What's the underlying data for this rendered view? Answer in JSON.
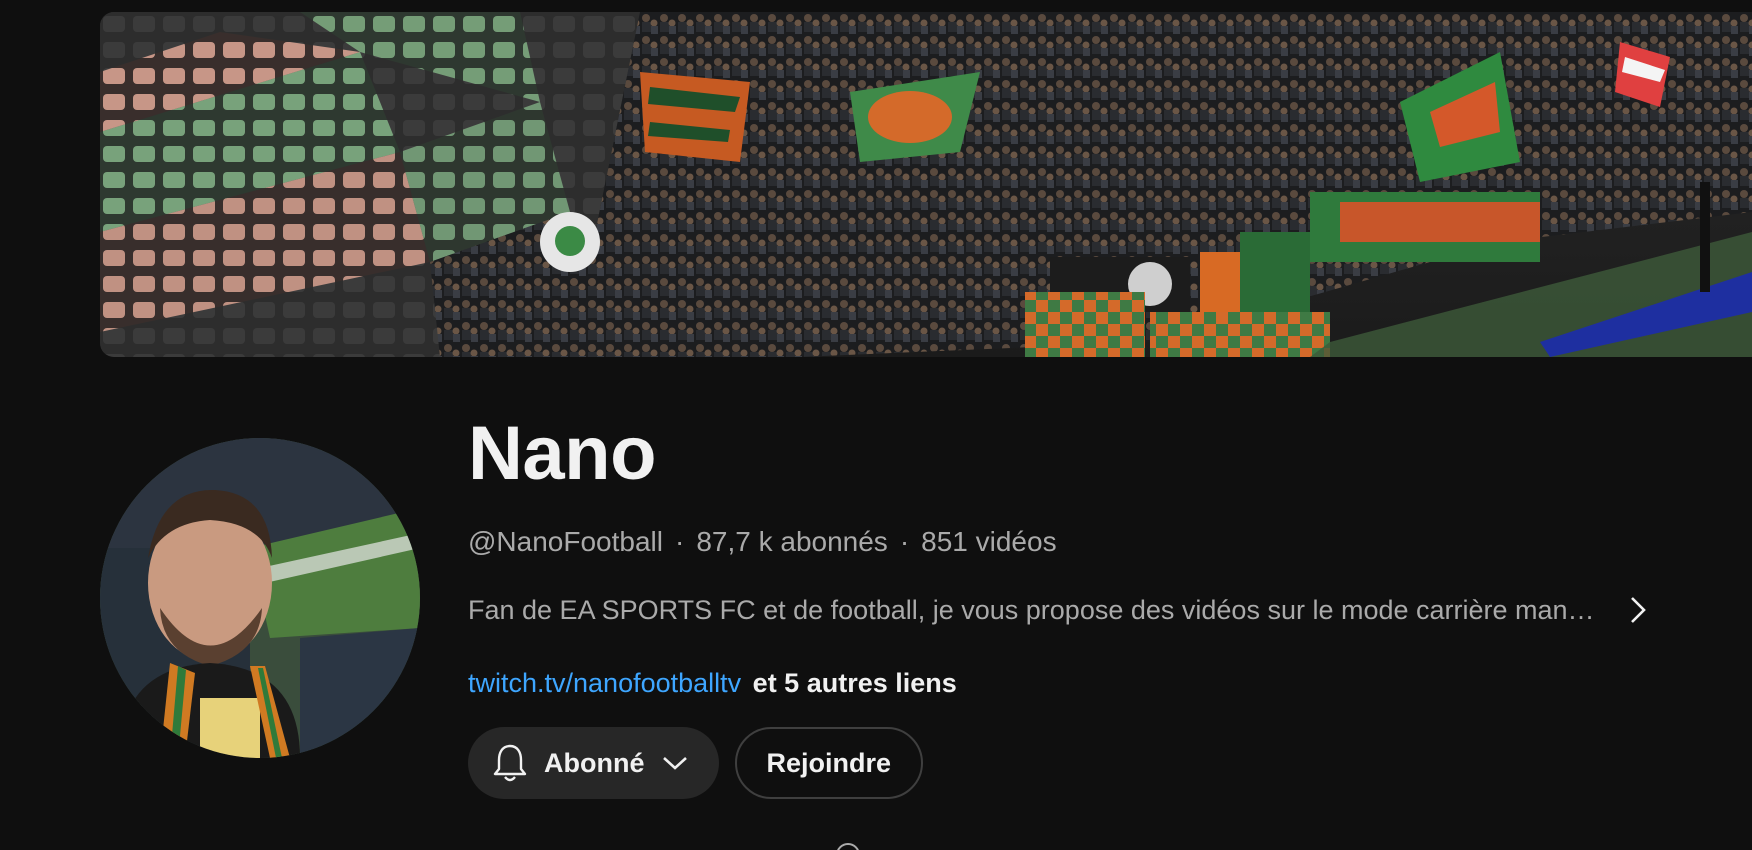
{
  "channel": {
    "name": "Nano",
    "handle": "@NanoFootball",
    "subscribers": "87,7 k abonnés",
    "videos": "851 vidéos",
    "separator": "·",
    "description": "Fan de EA SPORTS FC et de football, je vous propose des vidéos sur le mode carrière man…",
    "link_text": "twitch.tv/nanofootballtv",
    "more_links": "et 5 autres liens"
  },
  "actions": {
    "subscribed_label": "Abonné",
    "join_label": "Rejoindre"
  },
  "icons": {
    "bell": "bell-icon",
    "chevron_down": "chevron-down-icon",
    "chevron_right": "chevron-right-icon"
  },
  "colors": {
    "background": "#0f0f0f",
    "link": "#3ea6ff",
    "secondary_text": "#aaaaaa",
    "button_bg": "#272727"
  }
}
